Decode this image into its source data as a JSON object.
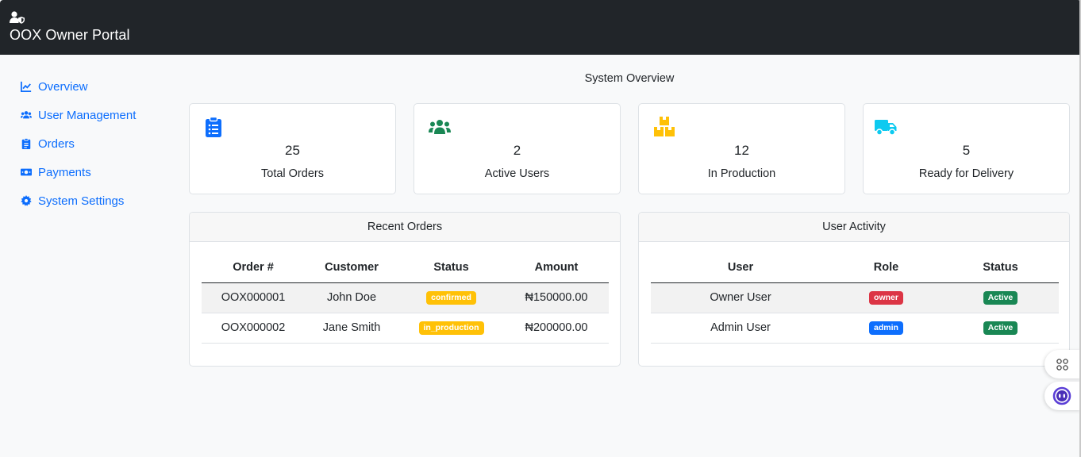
{
  "app": {
    "title": "OOX Owner Portal",
    "icon": "user-shield-icon"
  },
  "sidebar": {
    "items": [
      {
        "label": "Overview",
        "icon": "chart-line-icon"
      },
      {
        "label": "User Management",
        "icon": "users-icon"
      },
      {
        "label": "Orders",
        "icon": "clipboard-list-icon"
      },
      {
        "label": "Payments",
        "icon": "money-bill-icon"
      },
      {
        "label": "System Settings",
        "icon": "gear-icon"
      }
    ]
  },
  "main": {
    "title": "System Overview",
    "stats": [
      {
        "value": "25",
        "label": "Total Orders",
        "icon": "clipboard-list-icon",
        "color": "#0d6efd"
      },
      {
        "value": "2",
        "label": "Active Users",
        "icon": "users-icon",
        "color": "#198754"
      },
      {
        "value": "12",
        "label": "In Production",
        "icon": "boxes-icon",
        "color": "#ffc107"
      },
      {
        "value": "5",
        "label": "Ready for Delivery",
        "icon": "truck-icon",
        "color": "#0dcaf0"
      }
    ],
    "recent_orders": {
      "title": "Recent Orders",
      "columns": [
        "Order #",
        "Customer",
        "Status",
        "Amount"
      ],
      "rows": [
        {
          "order": "OOX000001",
          "customer": "John Doe",
          "status": "confirmed",
          "amount": "₦150000.00"
        },
        {
          "order": "OOX000002",
          "customer": "Jane Smith",
          "status": "in_production",
          "amount": "₦200000.00"
        }
      ]
    },
    "user_activity": {
      "title": "User Activity",
      "columns": [
        "User",
        "Role",
        "Status"
      ],
      "rows": [
        {
          "user": "Owner User",
          "role": "owner",
          "status": "Active"
        },
        {
          "user": "Admin User",
          "role": "admin",
          "status": "Active"
        }
      ]
    }
  },
  "floating": {
    "apps_icon": "apps-grid-icon",
    "assistant_icon": "assistant-face-icon"
  },
  "colors": {
    "navbar": "#212529",
    "link": "#0d6efd",
    "warning": "#ffc107",
    "danger": "#dc3545",
    "success": "#198754"
  }
}
